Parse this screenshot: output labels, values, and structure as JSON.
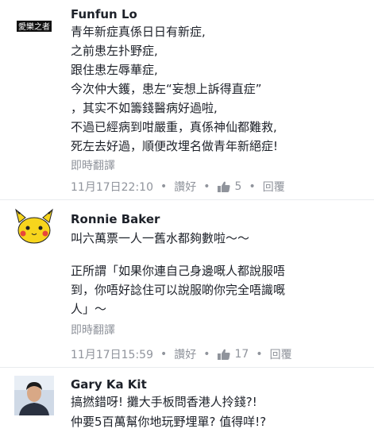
{
  "comments": [
    {
      "author": "Funfun Lo",
      "avatar_text": "愛樂之者",
      "lines": [
        "青年新症真係日日有新症,",
        "之前患左扑野症,",
        "跟住患左辱華症,",
        "今次仲大鑊，患左“妄想上訴得直症”",
        "，其实不如籌錢醫病好過啦,",
        "不過已經病到咁嚴重，真係神仙都難救,",
        "死左去好過，順便改埋名做青年新絕症!"
      ],
      "translate": "即時翻譯",
      "timestamp": "11月17日22:10",
      "like_label": "讚好",
      "like_count": "5",
      "reply_label": "回覆"
    },
    {
      "author": "Ronnie Baker",
      "lines": [
        "叫六萬票一人一舊水都夠數啦～～",
        "",
        "正所謂「如果你連自己身邊嘅人都說服唔",
        "到，你唔好諗住可以說服啲你完全唔識嘅",
        "人」～"
      ],
      "translate": "即時翻譯",
      "timestamp": "11月17日15:59",
      "like_label": "讚好",
      "like_count": "17",
      "reply_label": "回覆"
    },
    {
      "author": "Gary Ka Kit",
      "lines": [
        "搞撚錯呀! 攤大手板問香港人拎錢?!",
        "仲要5百萬幫你地玩野埋單? 值得咩!?"
      ]
    }
  ],
  "colors": {
    "text": "#1d2129",
    "meta": "#90949c",
    "divider": "#e9ebee"
  }
}
